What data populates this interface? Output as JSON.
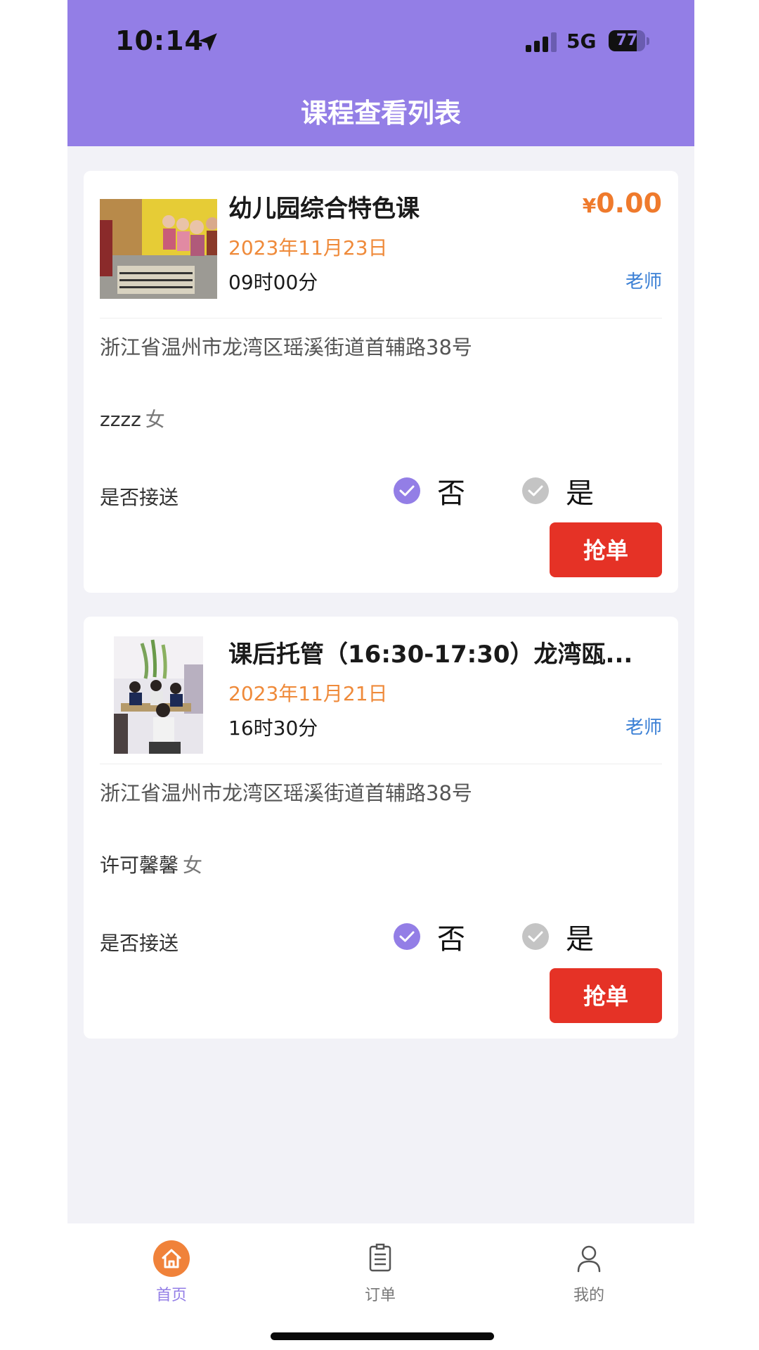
{
  "status_bar": {
    "time": "10:14",
    "network": "5G",
    "battery": "77",
    "battery_level": 0.77
  },
  "header": {
    "title": "课程查看列表"
  },
  "colors": {
    "header": "#937ee6",
    "price": "#ef7a2c",
    "date": "#ef8a3a",
    "link": "#3a7fd5",
    "button": "#e53226",
    "radio_on": "#937ee6",
    "radio_off": "#c4c4c4"
  },
  "courses": [
    {
      "title": "幼儿园综合特色课",
      "price_symbol": "¥",
      "price_value": "0.00",
      "date": "2023年11月23日",
      "time": "09时00分",
      "role": "老师",
      "address": "浙江省温州市龙湾区瑶溪街道首辅路38号",
      "student": "zzzz",
      "gender": "女",
      "pickup_label": "是否接送",
      "pickup_no": "否",
      "pickup_yes": "是",
      "pickup_selected": "否",
      "button": "抢单",
      "image_icon": "kindergarten-class-photo"
    },
    {
      "title": "课后托管（16:30-17:30）龙湾瓯...",
      "date": "2023年11月21日",
      "time": "16时30分",
      "role": "老师",
      "address": "浙江省温州市龙湾区瑶溪街道首辅路38号",
      "student": "许可馨馨",
      "gender": "女",
      "pickup_label": "是否接送",
      "pickup_no": "否",
      "pickup_yes": "是",
      "pickup_selected": "否",
      "button": "抢单",
      "image_icon": "after-school-class-photo"
    }
  ],
  "tabbar": {
    "items": [
      {
        "label": "首页",
        "icon": "home-icon",
        "active": true
      },
      {
        "label": "订单",
        "icon": "order-list-icon",
        "active": false
      },
      {
        "label": "我的",
        "icon": "user-icon",
        "active": false
      }
    ]
  }
}
